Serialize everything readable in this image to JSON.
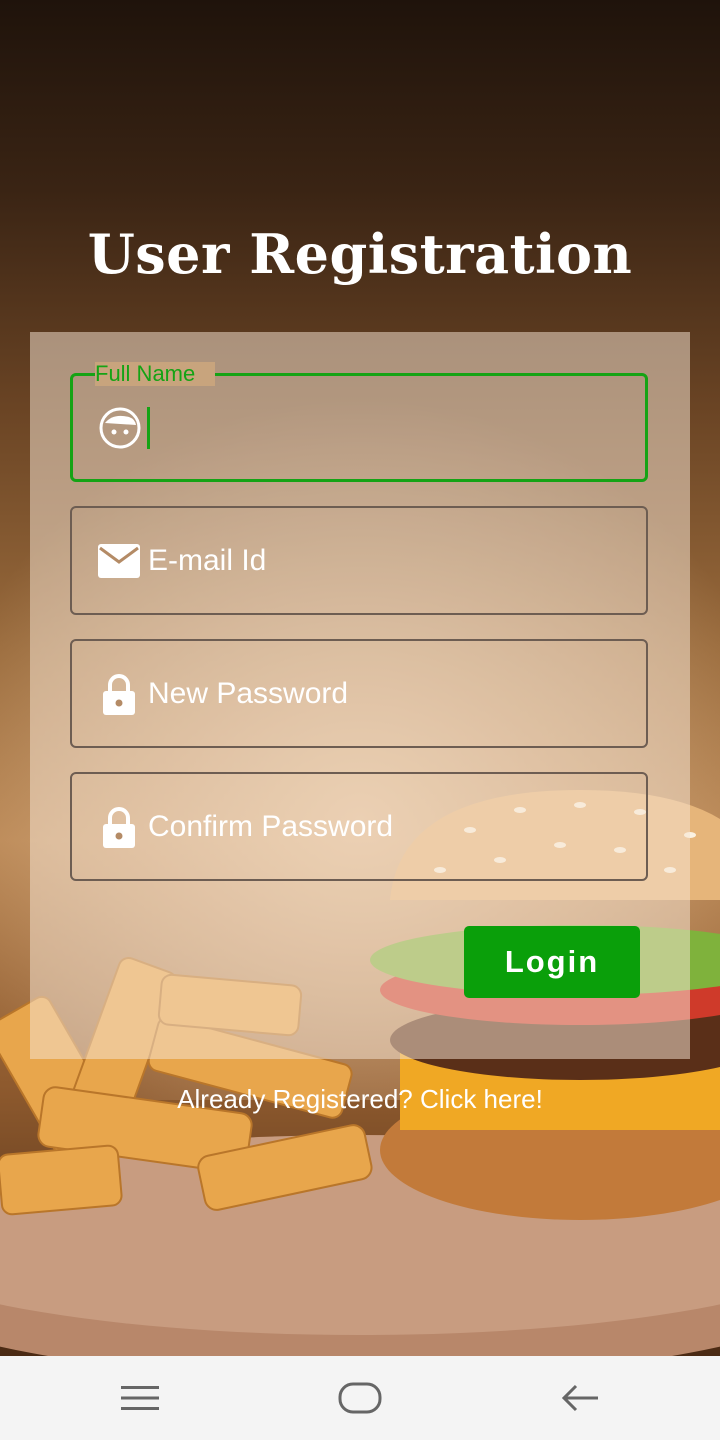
{
  "title": "User Registration",
  "form": {
    "full_name": {
      "label": "Full Name",
      "value": "",
      "icon": "face-icon"
    },
    "email": {
      "placeholder": "E-mail Id",
      "icon": "mail-icon"
    },
    "new_password": {
      "placeholder": "New Password",
      "icon": "lock-icon"
    },
    "confirm_password": {
      "placeholder": "Confirm Password",
      "icon": "lock-icon"
    },
    "submit_label": "Login"
  },
  "register_link": "Already Registered? Click here!",
  "colors": {
    "accent": "#15a315",
    "button": "#0a9f0a",
    "text": "#ffffff"
  },
  "navbar": {
    "icons": [
      "menu-icon",
      "home-icon",
      "back-icon"
    ]
  }
}
